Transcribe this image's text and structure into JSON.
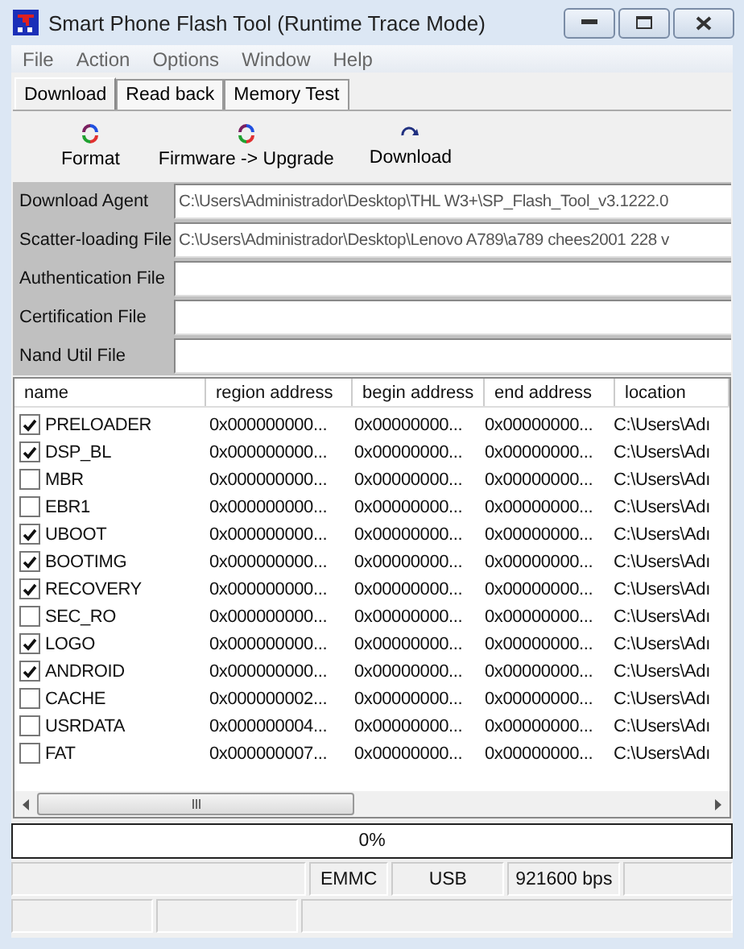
{
  "window": {
    "title": "Smart Phone Flash Tool (Runtime Trace Mode)"
  },
  "menu": [
    "File",
    "Action",
    "Options",
    "Window",
    "Help"
  ],
  "tabs": [
    {
      "label": "Download",
      "selected": true
    },
    {
      "label": "Read back",
      "selected": false
    },
    {
      "label": "Memory Test",
      "selected": false
    }
  ],
  "toolbar": [
    {
      "label": "Format",
      "kind": "format"
    },
    {
      "label": "Firmware -> Upgrade",
      "kind": "format"
    },
    {
      "label": "Download",
      "kind": "download"
    }
  ],
  "files": [
    {
      "label": "Download Agent",
      "value": "C:\\Users\\Administrador\\Desktop\\THL W3+\\SP_Flash_Tool_v3.1222.0"
    },
    {
      "label": "Scatter-loading File",
      "value": "C:\\Users\\Administrador\\Desktop\\Lenovo A789\\a789 chees2001 228 v"
    },
    {
      "label": "Authentication File"
    },
    {
      "label": "Certification File"
    },
    {
      "label": "Nand Util File"
    }
  ],
  "table": {
    "columns": [
      "name",
      "region address",
      "begin address",
      "end address",
      "location"
    ],
    "rows": [
      {
        "name": "PRELOADER",
        "checked": true,
        "region": "0x000000000...",
        "begin": "0x00000000...",
        "end": "0x00000000...",
        "location": "C:\\Users\\Adı"
      },
      {
        "name": "DSP_BL",
        "checked": true,
        "region": "0x000000000...",
        "begin": "0x00000000...",
        "end": "0x00000000...",
        "location": "C:\\Users\\Adı"
      },
      {
        "name": "MBR",
        "checked": false,
        "region": "0x000000000...",
        "begin": "0x00000000...",
        "end": "0x00000000...",
        "location": "C:\\Users\\Adı"
      },
      {
        "name": "EBR1",
        "checked": false,
        "region": "0x000000000...",
        "begin": "0x00000000...",
        "end": "0x00000000...",
        "location": "C:\\Users\\Adı"
      },
      {
        "name": "UBOOT",
        "checked": true,
        "region": "0x000000000...",
        "begin": "0x00000000...",
        "end": "0x00000000...",
        "location": "C:\\Users\\Adı"
      },
      {
        "name": "BOOTIMG",
        "checked": true,
        "region": "0x000000000...",
        "begin": "0x00000000...",
        "end": "0x00000000...",
        "location": "C:\\Users\\Adı"
      },
      {
        "name": "RECOVERY",
        "checked": true,
        "region": "0x000000000...",
        "begin": "0x00000000...",
        "end": "0x00000000...",
        "location": "C:\\Users\\Adı"
      },
      {
        "name": "SEC_RO",
        "checked": false,
        "region": "0x000000000...",
        "begin": "0x00000000...",
        "end": "0x00000000...",
        "location": "C:\\Users\\Adı"
      },
      {
        "name": "LOGO",
        "checked": true,
        "region": "0x000000000...",
        "begin": "0x00000000...",
        "end": "0x00000000...",
        "location": "C:\\Users\\Adı"
      },
      {
        "name": "ANDROID",
        "checked": true,
        "region": "0x000000000...",
        "begin": "0x00000000...",
        "end": "0x00000000...",
        "location": "C:\\Users\\Adı"
      },
      {
        "name": "CACHE",
        "checked": false,
        "region": "0x000000002...",
        "begin": "0x00000000...",
        "end": "0x00000000...",
        "location": "C:\\Users\\Adı"
      },
      {
        "name": "USRDATA",
        "checked": false,
        "region": "0x000000004...",
        "begin": "0x00000000...",
        "end": "0x00000000...",
        "location": "C:\\Users\\Adı"
      },
      {
        "name": "FAT",
        "checked": false,
        "region": "0x000000007...",
        "begin": "0x00000000...",
        "end": "0x00000000...",
        "location": "C:\\Users\\Adı"
      }
    ]
  },
  "progress": {
    "level": 0,
    "text": "0%"
  },
  "status": [
    "EMMC",
    "USB",
    "921600 bps"
  ]
}
